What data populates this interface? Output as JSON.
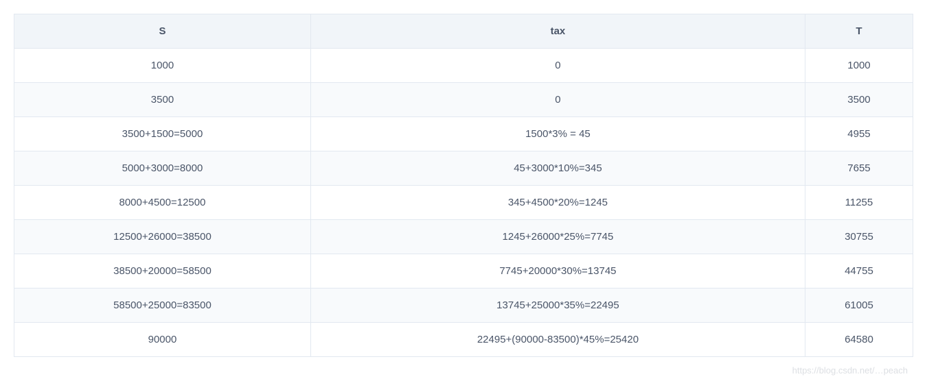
{
  "table": {
    "headers": {
      "s": "S",
      "tax": "tax",
      "t": "T"
    },
    "rows": [
      {
        "s": "1000",
        "tax": "0",
        "t": "1000"
      },
      {
        "s": "3500",
        "tax": "0",
        "t": "3500"
      },
      {
        "s": "3500+1500=5000",
        "tax": "1500*3% = 45",
        "t": "4955"
      },
      {
        "s": "5000+3000=8000",
        "tax": "45+3000*10%=345",
        "t": "7655"
      },
      {
        "s": "8000+4500=12500",
        "tax": "345+4500*20%=1245",
        "t": "11255"
      },
      {
        "s": "12500+26000=38500",
        "tax": "1245+26000*25%=7745",
        "t": "30755"
      },
      {
        "s": "38500+20000=58500",
        "tax": "7745+20000*30%=13745",
        "t": "44755"
      },
      {
        "s": "58500+25000=83500",
        "tax": "13745+25000*35%=22495",
        "t": "61005"
      },
      {
        "s": "90000",
        "tax": "22495+(90000-83500)*45%=25420",
        "t": "64580"
      }
    ]
  },
  "watermark": "https://blog.csdn.net/…peach"
}
